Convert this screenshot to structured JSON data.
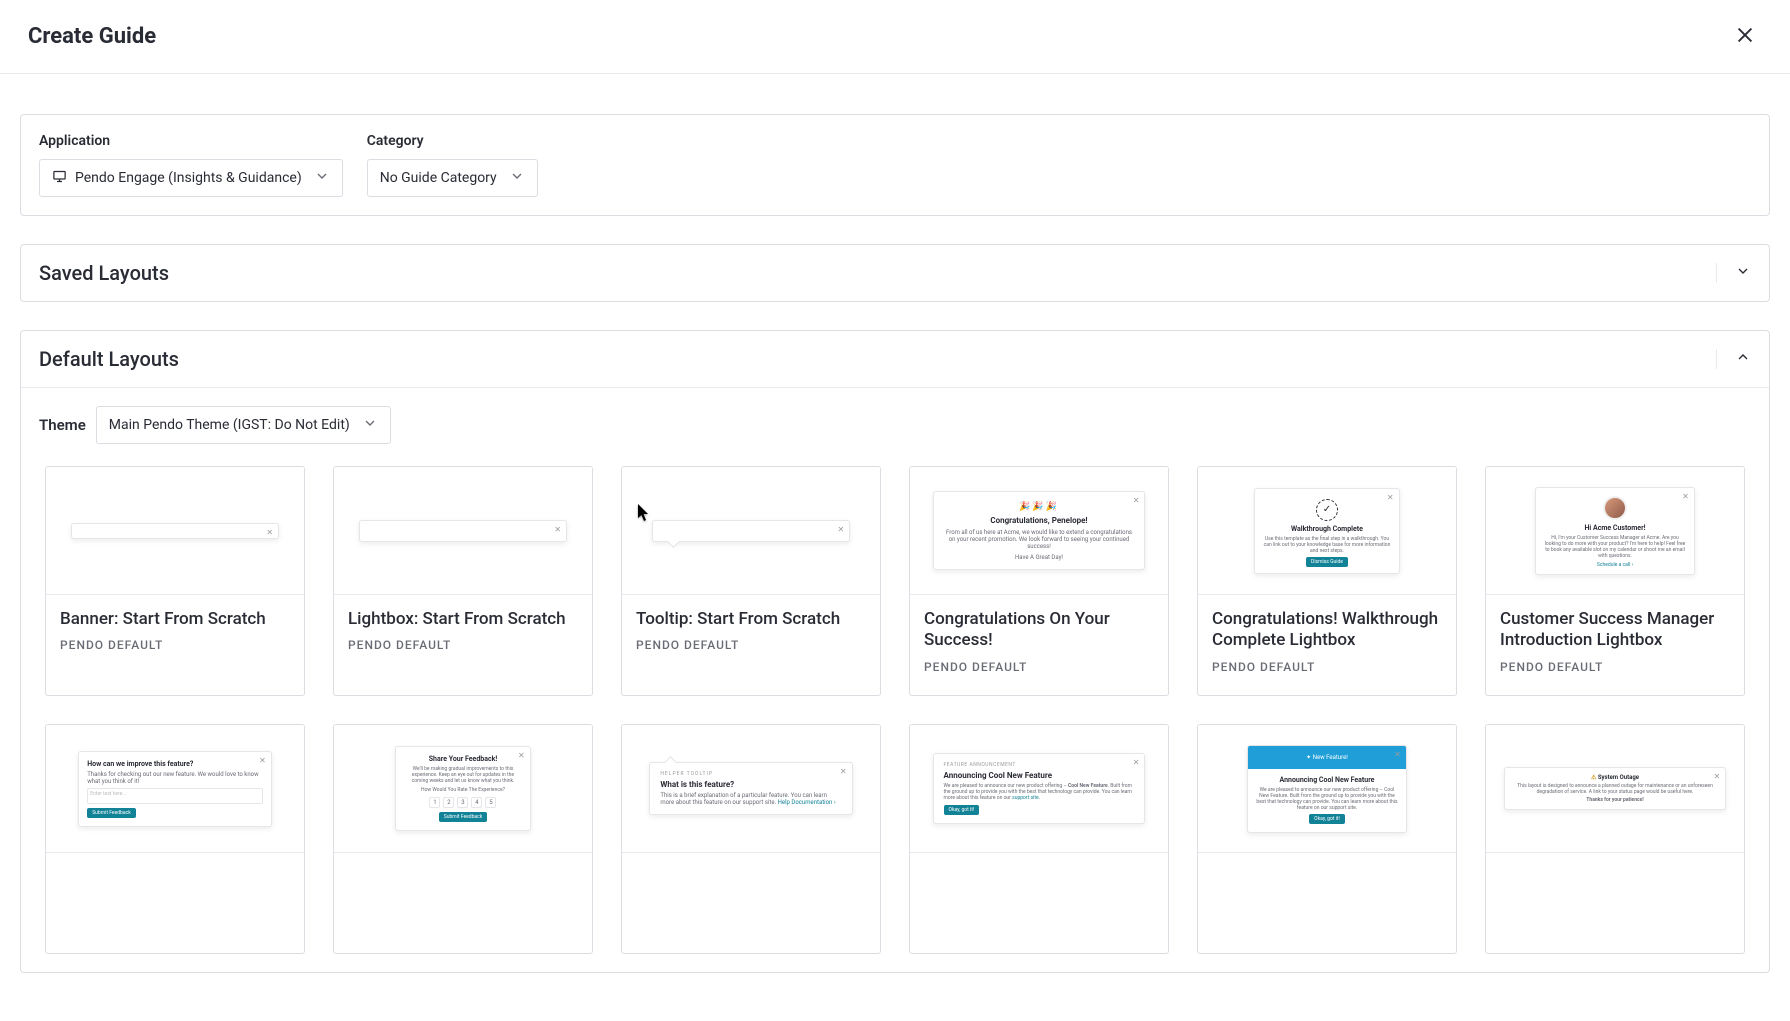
{
  "header": {
    "title": "Create Guide"
  },
  "config": {
    "application_label": "Application",
    "application_value": "Pendo Engage (Insights & Guidance)",
    "category_label": "Category",
    "category_value": "No Guide Category"
  },
  "sections": {
    "saved": {
      "title": "Saved Layouts",
      "expanded": false
    },
    "default": {
      "title": "Default Layouts",
      "expanded": true
    }
  },
  "theme": {
    "label": "Theme",
    "value": "Main Pendo Theme (IGST: Do Not Edit)"
  },
  "layouts": [
    {
      "title": "Banner: Start From Scratch",
      "subtitle": "PENDO DEFAULT",
      "preview": "banner"
    },
    {
      "title": "Lightbox: Start From Scratch",
      "subtitle": "PENDO DEFAULT",
      "preview": "lightbox"
    },
    {
      "title": "Tooltip: Start From Scratch",
      "subtitle": "PENDO DEFAULT",
      "preview": "tooltip"
    },
    {
      "title": "Congratulations On Your Success!",
      "subtitle": "PENDO DEFAULT",
      "preview": "congrats",
      "p": {
        "emoji": "🎉🎉🎉",
        "heading": "Congratulations, Penelope!",
        "body": "From all of us here at Acme, we would like to extend a congratulations on your recent promotion. We look forward to seeing your continued success!",
        "footer": "Have A Great Day!"
      }
    },
    {
      "title": "Congratulations! Walkthrough Complete Lightbox",
      "subtitle": "PENDO DEFAULT",
      "preview": "walkthrough",
      "p": {
        "heading": "Walkthrough Complete",
        "body": "Use this template as the final step in a walkthrough. You can link out to your knowledge base for more information and next steps.",
        "button": "Dismiss Guide"
      }
    },
    {
      "title": "Customer Success Manager Introduction Lightbox",
      "subtitle": "PENDO DEFAULT",
      "preview": "csm",
      "p": {
        "heading": "Hi Acme Customer!",
        "body": "Hi, I'm your Customer Success Manager at Acme. Are you looking to do more with your product? I'm here to help! Feel free to book any available slot on my calendar or shoot me an email with questions.",
        "link": "Schedule a call ›"
      }
    },
    {
      "title": "",
      "subtitle": "",
      "preview": "feedback",
      "p": {
        "heading": "How can we improve this feature?",
        "body": "Thanks for checking out our new feature. We would love to know what you think of it!",
        "placeholder": "Enter text here...",
        "button": "Submit Feedback"
      }
    },
    {
      "title": "",
      "subtitle": "",
      "preview": "share",
      "p": {
        "heading": "Share Your Feedback!",
        "body": "We'll be making gradual improvements to this experience. Keep an eye out for updates in the coming weeks and let us know what you think.",
        "question": "How Would You Rate The Experience?",
        "options": [
          "1",
          "2",
          "3",
          "4",
          "5"
        ],
        "button": "Submit Feedback"
      }
    },
    {
      "title": "",
      "subtitle": "",
      "preview": "helper",
      "p": {
        "tag": "HELPER TOOLTIP",
        "heading": "What is this feature?",
        "body": "This is a brief explanation of a particular feature. You can learn more about this feature on our support site.",
        "link": "Help Documentation ›"
      }
    },
    {
      "title": "",
      "subtitle": "",
      "preview": "announce",
      "p": {
        "tag": "FEATURE ANNOUNCEMENT",
        "heading": "Announcing Cool New Feature",
        "body1": "We are pleased to announce our new product offering – ",
        "bold": "Cool New Feature",
        "body2": ". Built from the ground up to provide you with the best that technology can provide. You can learn more about this feature on our ",
        "link": "support site",
        "button": "Okay, got it!"
      }
    },
    {
      "title": "",
      "subtitle": "",
      "preview": "announce-img",
      "p": {
        "hero": "✦ New Feature!",
        "heading": "Announcing Cool New Feature",
        "body": "We are pleased to announce our new product offering – Cool New Feature. Built from the ground up to provide you with the best that technology can provide. You can learn more about this feature on our support site.",
        "button": "Okay, got it!"
      }
    },
    {
      "title": "",
      "subtitle": "",
      "preview": "outage",
      "p": {
        "heading": "System Outage",
        "body": "This layout is designed to announce a planned outage for maintenance or an unforeseen degradation of service. A link to your status page would be useful here.",
        "footer": "Thanks for your patience!"
      }
    }
  ]
}
